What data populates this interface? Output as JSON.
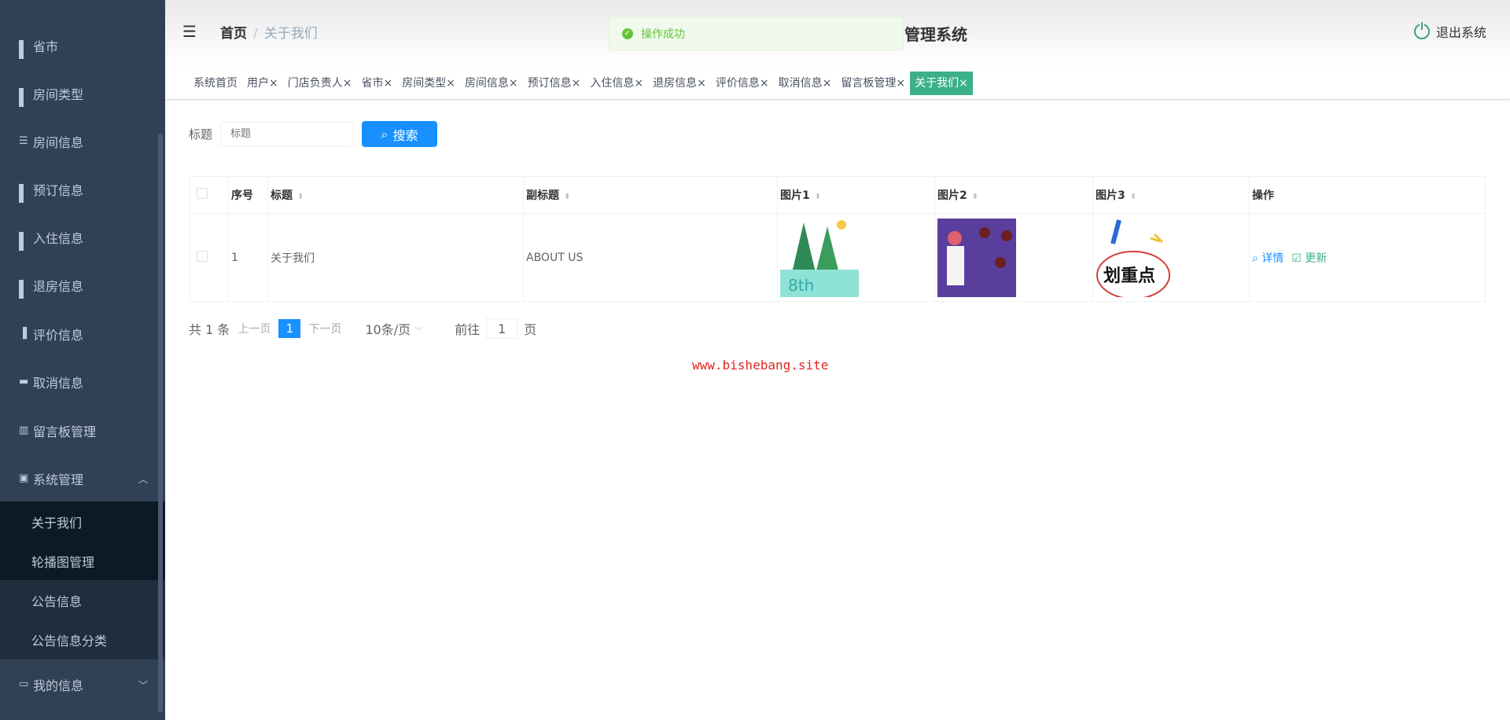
{
  "sidebar": {
    "items": [
      {
        "label": "省市",
        "icon": "grid-icon"
      },
      {
        "label": "房间类型",
        "icon": "grid-icon"
      },
      {
        "label": "房间信息",
        "icon": "list-icon"
      },
      {
        "label": "预订信息",
        "icon": "grid-icon"
      },
      {
        "label": "入住信息",
        "icon": "grid-icon"
      },
      {
        "label": "退房信息",
        "icon": "grid-icon"
      },
      {
        "label": "评价信息",
        "icon": "bar-chart-icon"
      },
      {
        "label": "取消信息",
        "icon": "monitor-icon"
      },
      {
        "label": "留言板管理",
        "icon": "book-icon"
      },
      {
        "label": "系统管理",
        "icon": "clipboard-icon"
      }
    ],
    "submenu": [
      "关于我们",
      "轮播图管理",
      "公告信息",
      "公告信息分类"
    ],
    "my_info": "我的信息"
  },
  "header": {
    "breadcrumb_home": "首页",
    "breadcrumb_current": "关于我们",
    "title": "管理系统",
    "logout": "退出系统",
    "toast": "操作成功"
  },
  "tabs": [
    "系统首页",
    "用户×",
    "门店负责人×",
    "省市×",
    "房间类型×",
    "房间信息×",
    "预订信息×",
    "入住信息×",
    "退房信息×",
    "评价信息×",
    "取消信息×",
    "留言板管理×",
    "关于我们×"
  ],
  "search": {
    "label": "标题",
    "placeholder": "标题",
    "button": "搜索"
  },
  "table": {
    "headers": [
      "序号",
      "标题",
      "副标题",
      "图片1",
      "图片2",
      "图片3",
      "操作"
    ],
    "rows": [
      {
        "index": "1",
        "title": "关于我们",
        "subtitle": "ABOUT US",
        "detail": "详情",
        "update": "更新",
        "img3_text": "划重点"
      }
    ]
  },
  "pagination": {
    "total": "共 1 条",
    "prev": "上一页",
    "page": "1",
    "next": "下一页",
    "size": "10条/页",
    "goto": "前往",
    "goto_value": "1",
    "page_suffix": "页"
  },
  "watermark": "www.bishebang.site",
  "colors": {
    "sidebar": "#304156",
    "accent": "#1890ff",
    "active_tab": "#3cb08a"
  }
}
